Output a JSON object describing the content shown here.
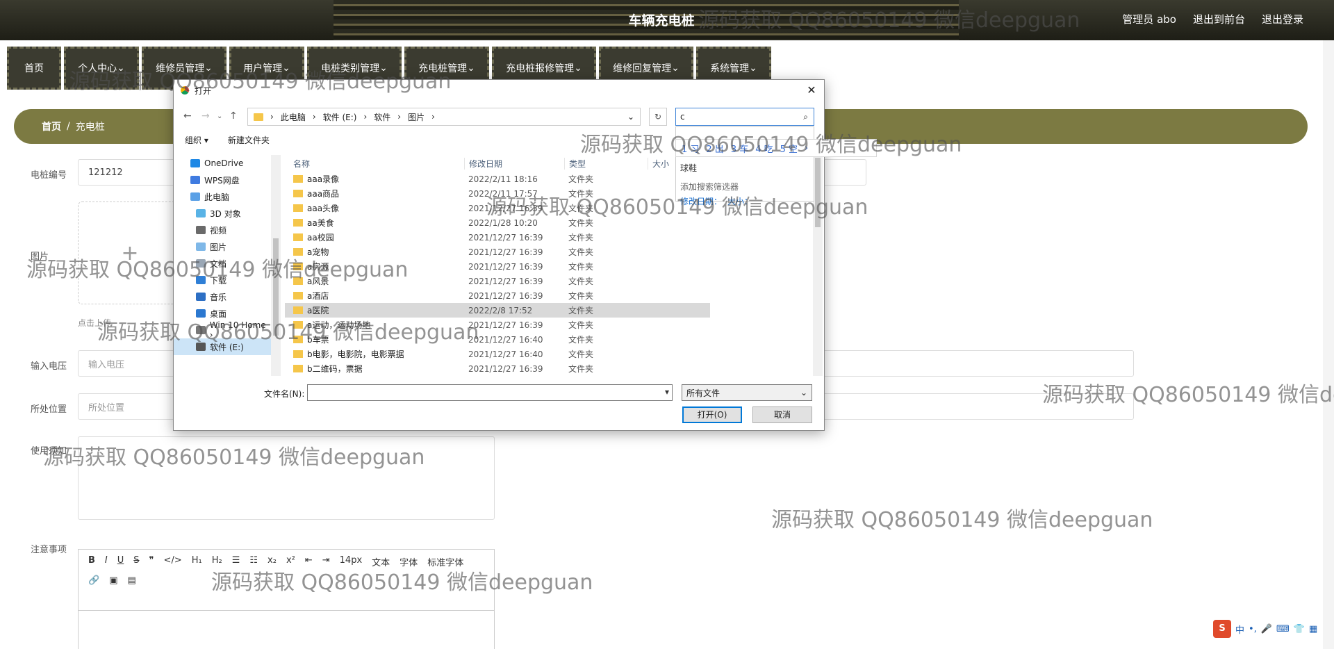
{
  "header": {
    "site_title": "车辆充电桩",
    "links": [
      "管理员 abo",
      "退出到前台",
      "退出登录"
    ]
  },
  "nav": [
    "首页",
    "个人中心",
    "维修员管理",
    "用户管理",
    "电桩类别管理",
    "充电桩管理",
    "充电桩报修管理",
    "维修回复管理",
    "系统管理"
  ],
  "breadcrumb": {
    "home": "首页",
    "sep": "/",
    "current": "充电桩"
  },
  "form": {
    "code_label": "电桩编号",
    "code_value": "121212",
    "image_label": "图片",
    "upload_hint": "点击上传",
    "voltage_label": "输入电压",
    "voltage_placeholder": "输入电压",
    "location_label": "所处位置",
    "location_placeholder": "所处位置",
    "usage_label": "使用须知",
    "notes_label": "注意事项",
    "editor_font_size": "14px",
    "editor_text_type": "文本",
    "editor_font_family": "标准字体",
    "editor_font_short": "字体"
  },
  "dialog": {
    "title": "打开",
    "path": [
      "此电脑",
      "软件 (E:)",
      "软件",
      "图片"
    ],
    "search_value": "c",
    "organize": "组织 ▾",
    "new_folder": "新建文件夹",
    "tree": [
      "OneDrive",
      "WPS网盘",
      "此电脑",
      "3D 对象",
      "视频",
      "图片",
      "文档",
      "下载",
      "音乐",
      "桌面",
      "Win 10 Home ›",
      "软件 (E:)"
    ],
    "columns": {
      "name": "名称",
      "date": "修改日期",
      "type": "类型",
      "size": "大小"
    },
    "files": [
      {
        "name": "aaa录像",
        "date": "2022/2/11 18:16",
        "type": "文件夹"
      },
      {
        "name": "aaa商品",
        "date": "2022/2/11 17:57",
        "type": "文件夹"
      },
      {
        "name": "aaa头像",
        "date": "2021/12/27 16:39",
        "type": "文件夹"
      },
      {
        "name": "aa美食",
        "date": "2022/1/28 10:20",
        "type": "文件夹"
      },
      {
        "name": "aa校园",
        "date": "2021/12/27 16:39",
        "type": "文件夹"
      },
      {
        "name": "a宠物",
        "date": "2021/12/27 16:39",
        "type": "文件夹"
      },
      {
        "name": "a房源",
        "date": "2021/12/27 16:39",
        "type": "文件夹"
      },
      {
        "name": "a风景",
        "date": "2021/12/27 16:39",
        "type": "文件夹"
      },
      {
        "name": "a酒店",
        "date": "2021/12/27 16:39",
        "type": "文件夹"
      },
      {
        "name": "a医院",
        "date": "2022/2/8 17:52",
        "type": "文件夹"
      },
      {
        "name": "a运动，运动场地",
        "date": "2021/12/27 16:39",
        "type": "文件夹"
      },
      {
        "name": "b车票",
        "date": "2021/12/27 16:40",
        "type": "文件夹"
      },
      {
        "name": "b电影，电影院，电影票据",
        "date": "2021/12/27 16:40",
        "type": "文件夹"
      },
      {
        "name": "b二维码，票据",
        "date": "2021/12/27 16:39",
        "type": "文件夹"
      }
    ],
    "filename_label": "文件名(N):",
    "filetype_value": "所有文件",
    "open_button": "打开(O)",
    "cancel_button": "取消"
  },
  "search_popup": {
    "suggestion": "球鞋",
    "add_filter": "添加搜索筛选器",
    "modified_date": "修改日期：",
    "size_filter": "大小："
  },
  "ime_candidates": [
    "1 习",
    "2 出",
    "3 车",
    "4 吃",
    "5 空"
  ],
  "watermark": "源码获取 QQ86050149 微信deepguan",
  "ime_bar": {
    "mode": "中",
    "punct": "•,",
    "logo": "S"
  }
}
